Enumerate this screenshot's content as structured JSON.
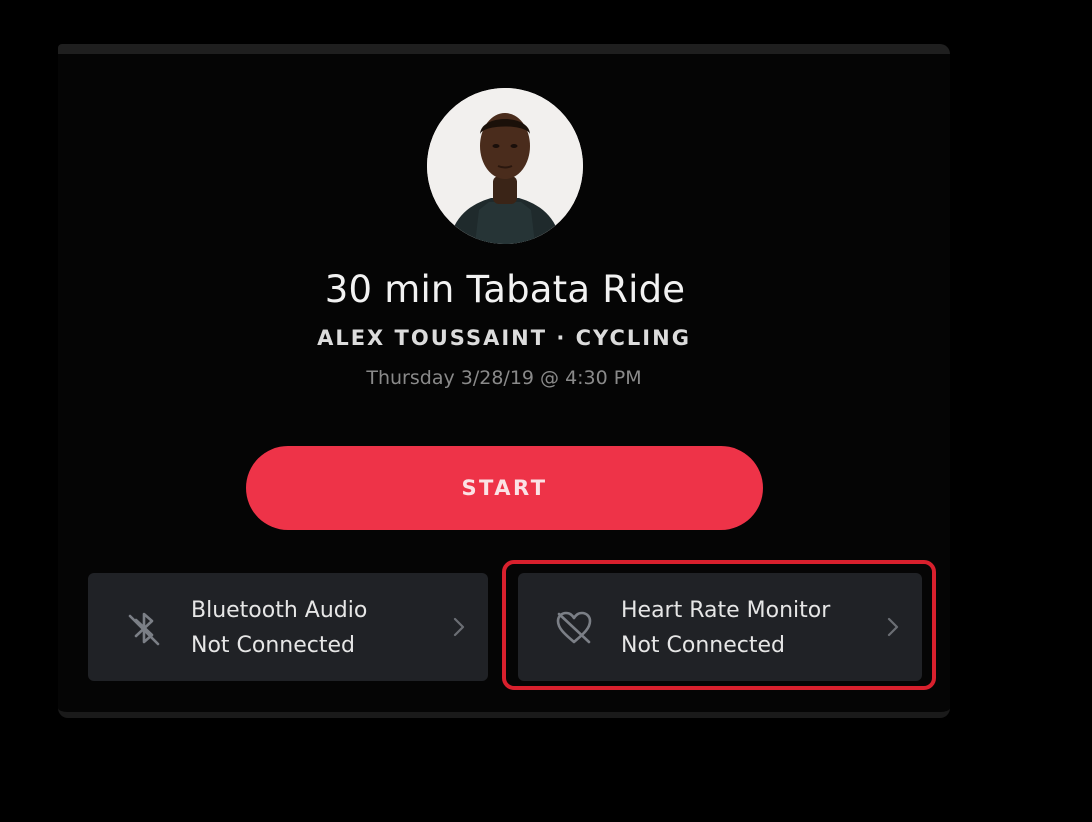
{
  "class": {
    "title": "30 min Tabata Ride",
    "instructor_category": "ALEX TOUSSAINT · CYCLING",
    "datetime": "Thursday 3/28/19 @ 4:30 PM",
    "avatar_icon": "instructor-avatar"
  },
  "actions": {
    "start_label": "START"
  },
  "devices": [
    {
      "name": "Bluetooth Audio",
      "status": "Not Connected",
      "icon": "bluetooth-off-icon"
    },
    {
      "name": "Heart Rate Monitor",
      "status": "Not Connected",
      "icon": "heart-off-icon"
    }
  ],
  "colors": {
    "background": "#000000",
    "accent": "#ee3348",
    "card": "#202226",
    "highlight": "#d8202d"
  }
}
